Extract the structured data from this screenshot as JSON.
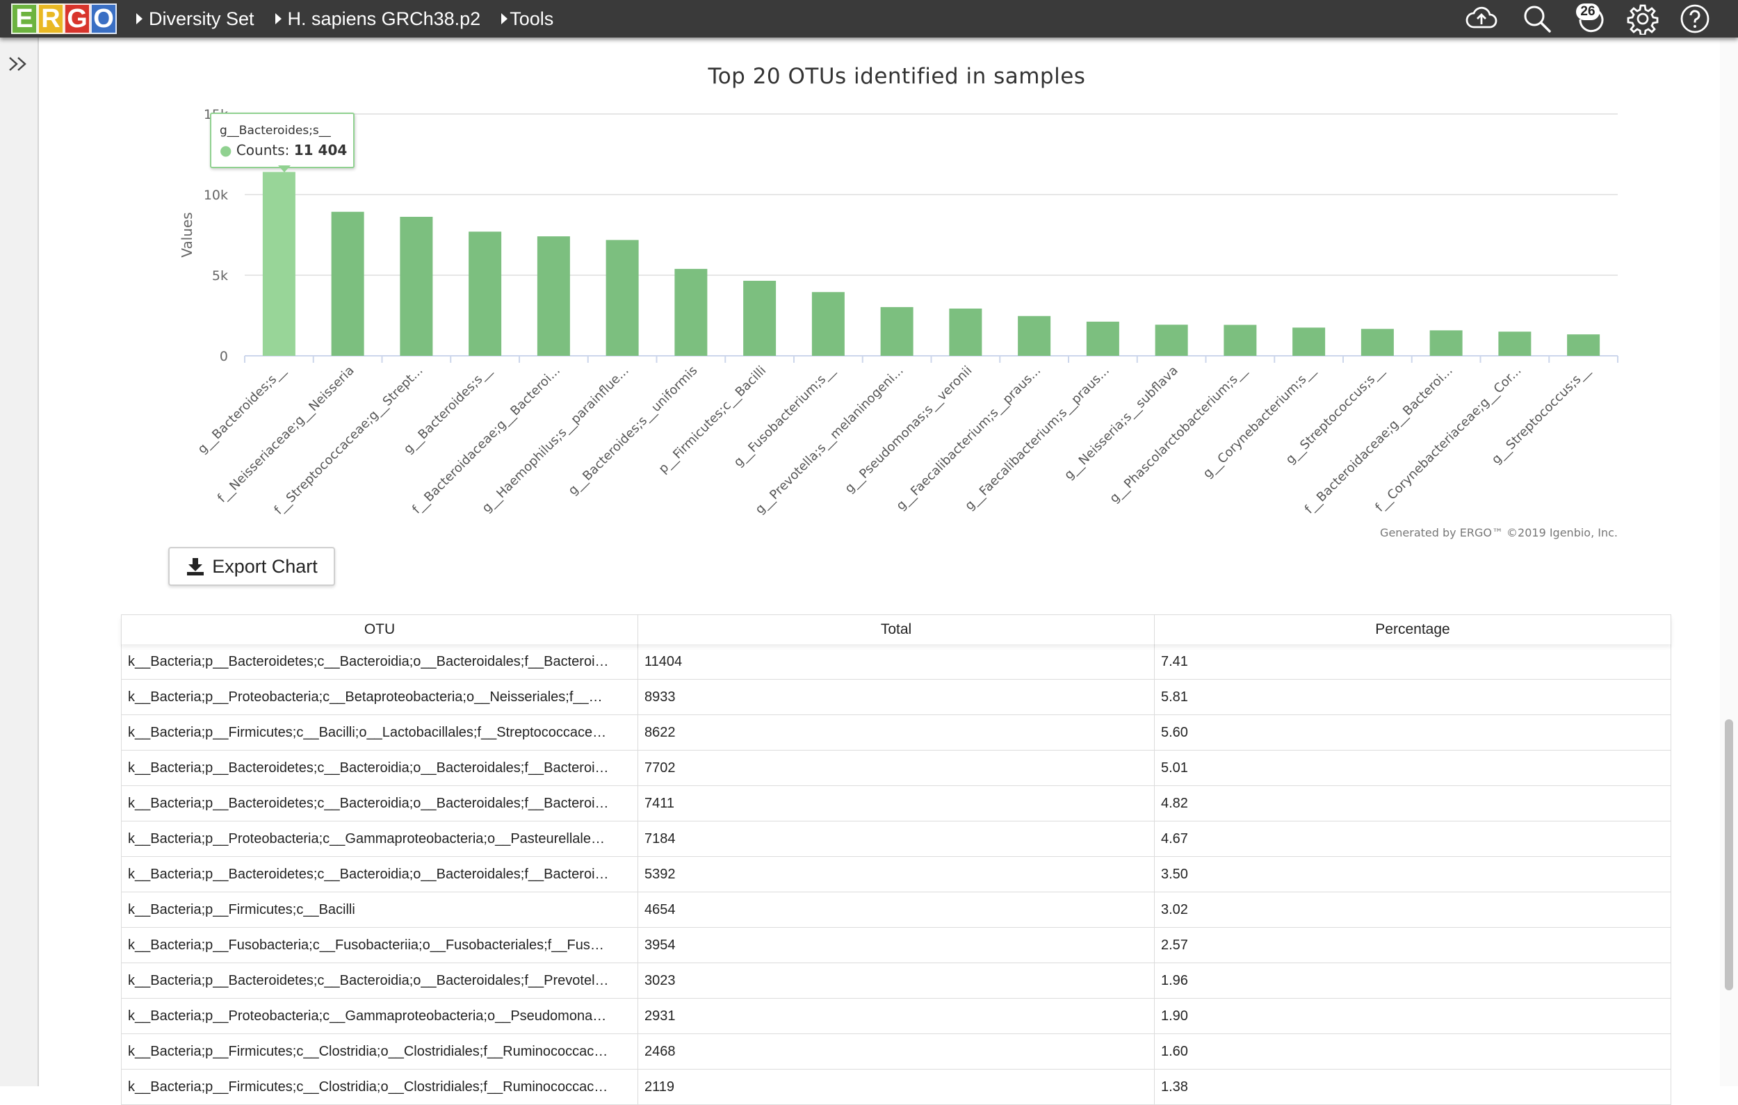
{
  "app": {
    "logo_letters": [
      "E",
      "R",
      "G",
      "O"
    ],
    "logo_colors": [
      "#6cb33f",
      "#e9b824",
      "#d8342c",
      "#3a6fc4"
    ]
  },
  "breadcrumbs": [
    "Diversity Set",
    "H. sapiens GRCh38.p2",
    "Tools"
  ],
  "header_icons": [
    "cloud-upload-icon",
    "search-icon",
    "history-icon",
    "gear-icon",
    "help-icon"
  ],
  "notification_count": "26",
  "chart_data": {
    "type": "bar",
    "title": "Top 20 OTUs identified in samples",
    "ylabel": "Values",
    "ylim": [
      0,
      15000
    ],
    "yticks": [
      "0",
      "5k",
      "10k",
      "15k"
    ],
    "bar_color": "#7cbf7f",
    "highlight_color": "#98d598",
    "grid": true,
    "legend": "none",
    "categories": [
      "g__Bacteroides;s__",
      "f__Neisseriaceae;g__Neisseria",
      "f__Streptococcaceae;g__Strept...",
      "g__Bacteroides;s__",
      "f__Bacteroidaceae;g__Bacteroi...",
      "g__Haemophilus;s__parainflue...",
      "g__Bacteroides;s__uniformis",
      "p__Firmicutes;c__Bacilli",
      "g__Fusobacterium;s__",
      "g__Prevotella;s__melaninogeni...",
      "g__Pseudomonas;s__veronii",
      "g__Faecalibacterium;s__praus...",
      "g__Faecalibacterium;s__praus...",
      "g__Neisseria;s__subflava",
      "g__Phascolarctobacterium;s__",
      "g__Corynebacterium;s__",
      "g__Streptococcus;s__",
      "f__Bacteroidaceae;g__Bacteroi...",
      "f__Corynebacteriaceae;g__Cor...",
      "g__Streptococcus;s__"
    ],
    "series": [
      {
        "values": [
          11404,
          8933,
          8622,
          7702,
          7411,
          7184,
          5392,
          4654,
          3954,
          3023,
          2931,
          2468,
          2119,
          1930,
          1920,
          1750,
          1670,
          1580,
          1500,
          1330
        ]
      }
    ],
    "tooltip": {
      "name": "g__Bacteroides;s__",
      "label": "Counts:",
      "value": "11 404"
    },
    "credit": "Generated by ERGO™ ©2019 Igenbio, Inc."
  },
  "export_button": "Export Chart",
  "table": {
    "headers": [
      "OTU",
      "Total",
      "Percentage"
    ],
    "rows": [
      [
        "k__Bacteria;p__Bacteroidetes;c__Bacteroidia;o__Bacteroidales;f__Bacteroi…",
        "11404",
        "7.41"
      ],
      [
        "k__Bacteria;p__Proteobacteria;c__Betaproteobacteria;o__Neisseriales;f__…",
        "8933",
        "5.81"
      ],
      [
        "k__Bacteria;p__Firmicutes;c__Bacilli;o__Lactobacillales;f__Streptococcace…",
        "8622",
        "5.60"
      ],
      [
        "k__Bacteria;p__Bacteroidetes;c__Bacteroidia;o__Bacteroidales;f__Bacteroi…",
        "7702",
        "5.01"
      ],
      [
        "k__Bacteria;p__Bacteroidetes;c__Bacteroidia;o__Bacteroidales;f__Bacteroi…",
        "7411",
        "4.82"
      ],
      [
        "k__Bacteria;p__Proteobacteria;c__Gammaproteobacteria;o__Pasteurellale…",
        "7184",
        "4.67"
      ],
      [
        "k__Bacteria;p__Bacteroidetes;c__Bacteroidia;o__Bacteroidales;f__Bacteroi…",
        "5392",
        "3.50"
      ],
      [
        "k__Bacteria;p__Firmicutes;c__Bacilli",
        "4654",
        "3.02"
      ],
      [
        "k__Bacteria;p__Fusobacteria;c__Fusobacteriia;o__Fusobacteriales;f__Fus…",
        "3954",
        "2.57"
      ],
      [
        "k__Bacteria;p__Bacteroidetes;c__Bacteroidia;o__Bacteroidales;f__Prevotel…",
        "3023",
        "1.96"
      ],
      [
        "k__Bacteria;p__Proteobacteria;c__Gammaproteobacteria;o__Pseudomona…",
        "2931",
        "1.90"
      ],
      [
        "k__Bacteria;p__Firmicutes;c__Clostridia;o__Clostridiales;f__Ruminococcac…",
        "2468",
        "1.60"
      ],
      [
        "k__Bacteria;p__Firmicutes;c__Clostridia;o__Clostridiales;f__Ruminococcac…",
        "2119",
        "1.38"
      ]
    ]
  }
}
